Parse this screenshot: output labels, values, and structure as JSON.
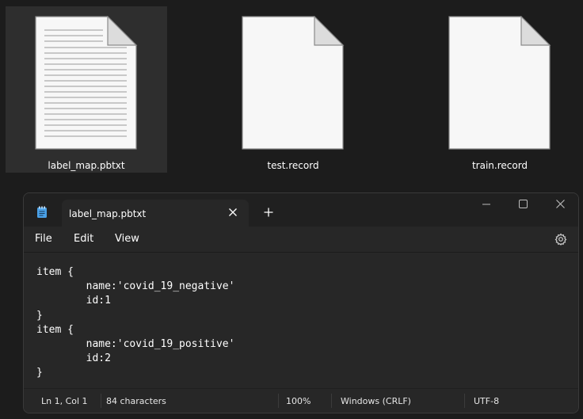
{
  "desktop": {
    "files": [
      {
        "name": "label_map.pbtxt",
        "icon": "text-file-icon",
        "selected": true
      },
      {
        "name": "test.record",
        "icon": "blank-file-icon",
        "selected": false
      },
      {
        "name": "train.record",
        "icon": "blank-file-icon",
        "selected": false
      }
    ]
  },
  "window": {
    "app": "Notepad",
    "tab_title": "label_map.pbtxt",
    "controls": [
      "minimize-icon",
      "maximize-icon",
      "close-icon"
    ],
    "menu": {
      "file": "File",
      "edit": "Edit",
      "view": "View"
    },
    "content": "item {\n\tname:'covid_19_negative'\n\tid:1\n}\nitem {\n\tname:'covid_19_positive'\n\tid:2\n}",
    "status": {
      "position": "Ln 1, Col 1",
      "characters": "84 characters",
      "zoom": "100%",
      "line_ending": "Windows (CRLF)",
      "encoding": "UTF-8"
    }
  },
  "colors": {
    "background": "#1c1c1c",
    "window": "#202020",
    "editor": "#272727",
    "notepad_icon": "#4aa0e6"
  }
}
